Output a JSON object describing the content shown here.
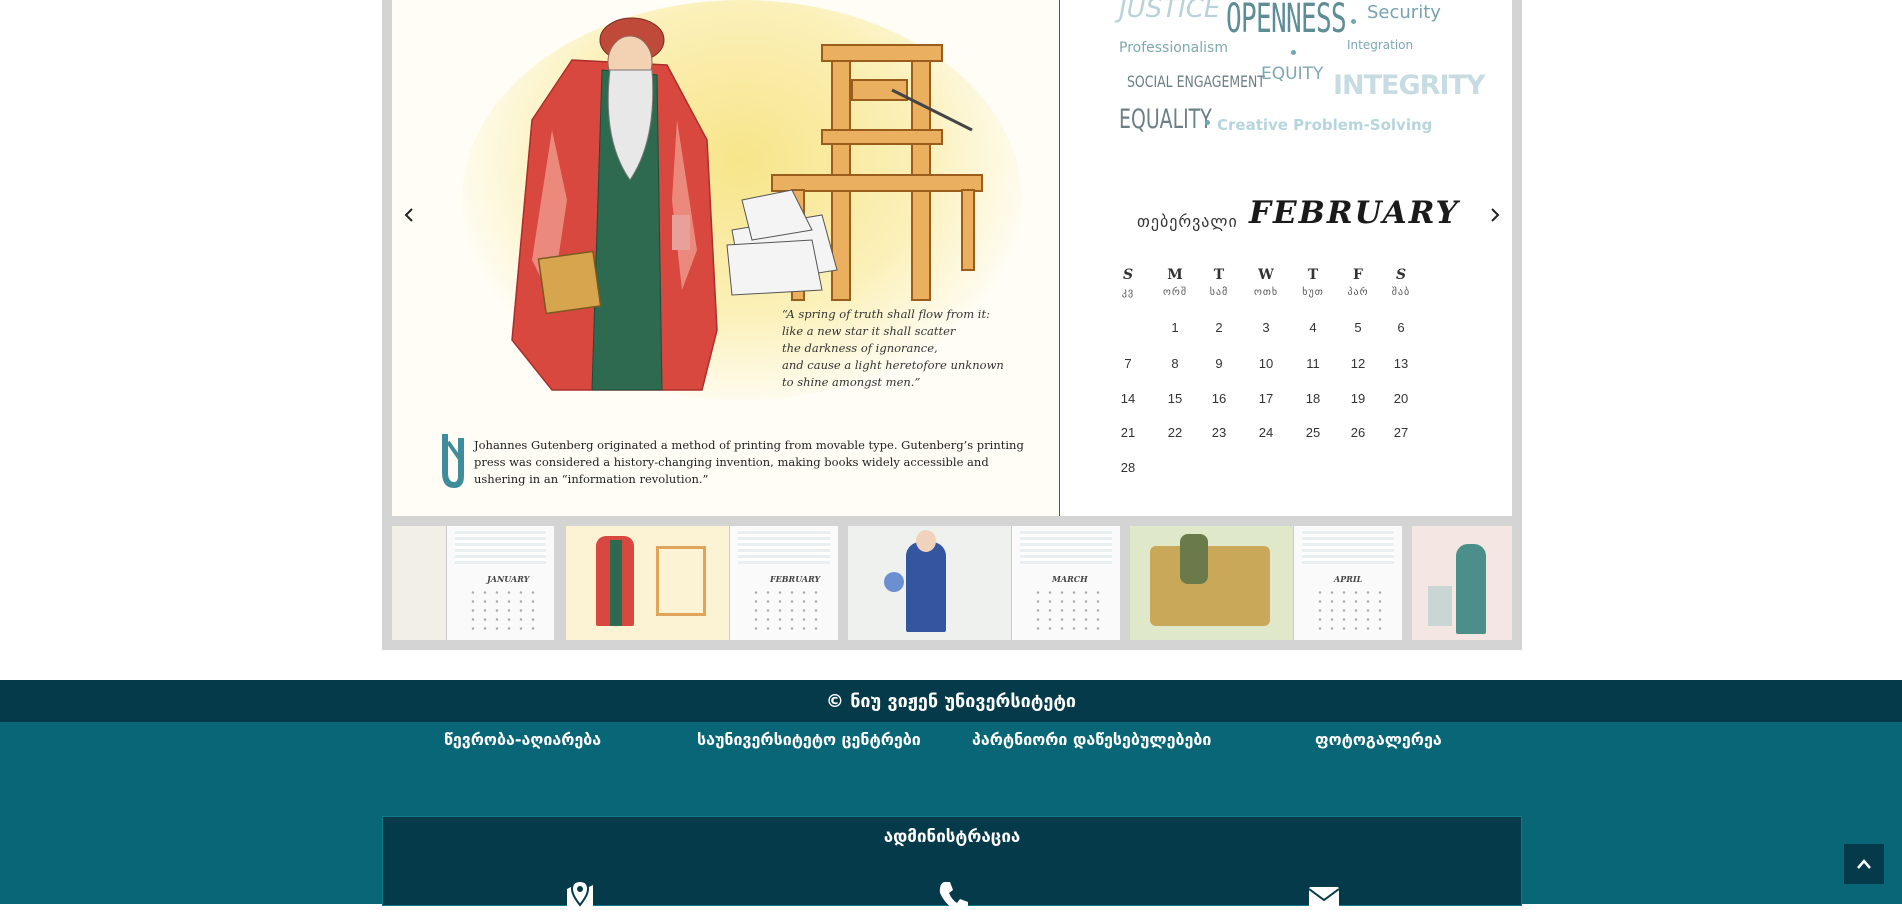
{
  "slide": {
    "quote": "“A spring of truth shall flow from it:\nlike a new star it shall scatter\nthe darkness of ignorance,\nand cause a light heretofore unknown\nto shine amongst men.”",
    "caption": "Johannes Gutenberg originated a method of printing from movable type. Gutenberg’s printing press was considered a history-changing invention, making books widely accessible and ushering in an “information revolution.”",
    "prev_icon": "chevron-left-icon",
    "next_icon": "chevron-right-icon"
  },
  "word_cloud": {
    "justice": "JUSTICE",
    "openness": "OPENNESS",
    "security": "Security",
    "professionalism": "Professionalism",
    "integration": "Integration",
    "social": "SOCIAL ENGAGEMENT",
    "equity": "EQUITY",
    "integrity": "INTEGRITY",
    "equality": "EQUALITY",
    "creative": "Creative Problem-Solving"
  },
  "calendar": {
    "month_ka": "თებერვალი",
    "month_en": "FEBRUARY",
    "weekdays_en": [
      "S",
      "M",
      "T",
      "W",
      "T",
      "F",
      "S"
    ],
    "weekdays_ka": [
      "კვ",
      "ორშ",
      "სამ",
      "ოთხ",
      "ხუთ",
      "პარ",
      "შაბ"
    ],
    "weeks": [
      [
        "",
        "1",
        "2",
        "3",
        "4",
        "5",
        "6"
      ],
      [
        "7",
        "8",
        "9",
        "10",
        "11",
        "12",
        "13"
      ],
      [
        "14",
        "15",
        "16",
        "17",
        "18",
        "19",
        "20"
      ],
      [
        "21",
        "22",
        "23",
        "24",
        "25",
        "26",
        "27"
      ],
      [
        "28",
        "",
        "",
        "",
        "",
        "",
        ""
      ]
    ]
  },
  "thumbnails": {
    "items": [
      {
        "month": "JANUARY",
        "active": false
      },
      {
        "month": "FEBRUARY",
        "active": true
      },
      {
        "month": "MARCH",
        "active": false
      },
      {
        "month": "APRIL",
        "active": false
      },
      {
        "month": "",
        "active": false
      }
    ]
  },
  "footer": {
    "copyright": "© ნიუ ვიჟენ უნივერსიტეტი",
    "links": [
      "წევრობა-აღიარება",
      "საუნივერსიტეტო ცენტრები",
      "პარტნიორი დაწესებულებები",
      "ფოტოგალერეა"
    ],
    "admin_title": "ადმინისტრაცია",
    "icons": [
      "map-marker-icon",
      "phone-icon",
      "envelope-icon"
    ],
    "back_to_top_icon": "chevron-up-icon"
  },
  "colors": {
    "footer_dark": "#053a4a",
    "footer_teal": "#086676",
    "cloud_teal": "#6fa9b3"
  }
}
